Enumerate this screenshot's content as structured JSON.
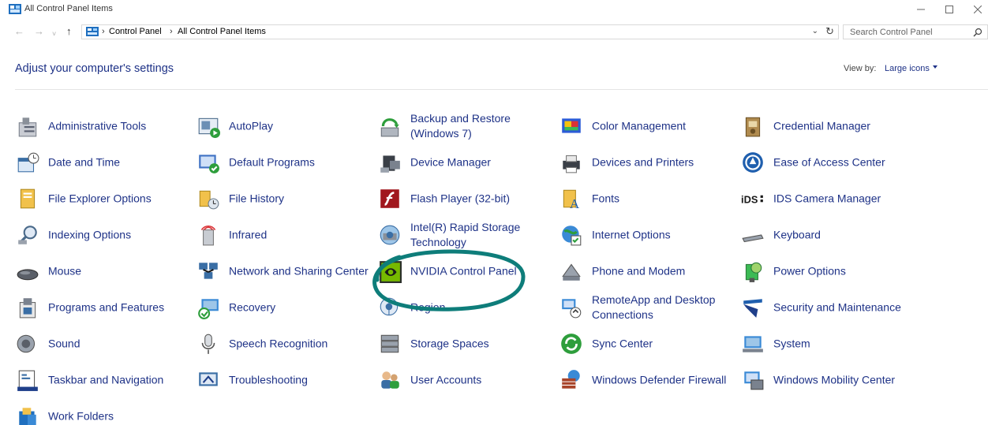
{
  "window": {
    "title": "All Control Panel Items"
  },
  "address": {
    "crumbs": [
      "Control Panel",
      "All Control Panel Items"
    ]
  },
  "search": {
    "placeholder": "Search Control Panel"
  },
  "header": {
    "heading": "Adjust your computer's settings",
    "view_by_label": "View by:",
    "view_by_value": "Large icons"
  },
  "items": [
    {
      "label": "Administrative Tools",
      "icon": "admin-tools-icon"
    },
    {
      "label": "AutoPlay",
      "icon": "autoplay-icon"
    },
    {
      "label": "Backup and Restore (Windows 7)",
      "icon": "backup-restore-icon"
    },
    {
      "label": "Color Management",
      "icon": "color-management-icon"
    },
    {
      "label": "Credential Manager",
      "icon": "credential-manager-icon"
    },
    {
      "label": "Date and Time",
      "icon": "date-time-icon"
    },
    {
      "label": "Default Programs",
      "icon": "default-programs-icon"
    },
    {
      "label": "Device Manager",
      "icon": "device-manager-icon"
    },
    {
      "label": "Devices and Printers",
      "icon": "devices-printers-icon"
    },
    {
      "label": "Ease of Access Center",
      "icon": "ease-of-access-icon"
    },
    {
      "label": "File Explorer Options",
      "icon": "file-explorer-options-icon"
    },
    {
      "label": "File History",
      "icon": "file-history-icon"
    },
    {
      "label": "Flash Player (32-bit)",
      "icon": "flash-player-icon"
    },
    {
      "label": "Fonts",
      "icon": "fonts-icon"
    },
    {
      "label": "IDS Camera Manager",
      "icon": "ids-camera-icon"
    },
    {
      "label": "Indexing Options",
      "icon": "indexing-options-icon"
    },
    {
      "label": "Infrared",
      "icon": "infrared-icon"
    },
    {
      "label": "Intel(R) Rapid Storage Technology",
      "icon": "intel-storage-icon"
    },
    {
      "label": "Internet Options",
      "icon": "internet-options-icon"
    },
    {
      "label": "Keyboard",
      "icon": "keyboard-icon"
    },
    {
      "label": "Mouse",
      "icon": "mouse-icon"
    },
    {
      "label": "Network and Sharing Center",
      "icon": "network-sharing-icon"
    },
    {
      "label": "NVIDIA Control Panel",
      "icon": "nvidia-icon"
    },
    {
      "label": "Phone and Modem",
      "icon": "phone-modem-icon"
    },
    {
      "label": "Power Options",
      "icon": "power-options-icon"
    },
    {
      "label": "Programs and Features",
      "icon": "programs-features-icon"
    },
    {
      "label": "Recovery",
      "icon": "recovery-icon"
    },
    {
      "label": "Region",
      "icon": "region-icon"
    },
    {
      "label": "RemoteApp and Desktop Connections",
      "icon": "remoteapp-icon"
    },
    {
      "label": "Security and Maintenance",
      "icon": "security-maintenance-icon"
    },
    {
      "label": "Sound",
      "icon": "sound-icon"
    },
    {
      "label": "Speech Recognition",
      "icon": "speech-recognition-icon"
    },
    {
      "label": "Storage Spaces",
      "icon": "storage-spaces-icon"
    },
    {
      "label": "Sync Center",
      "icon": "sync-center-icon"
    },
    {
      "label": "System",
      "icon": "system-icon"
    },
    {
      "label": "Taskbar and Navigation",
      "icon": "taskbar-icon"
    },
    {
      "label": "Troubleshooting",
      "icon": "troubleshooting-icon"
    },
    {
      "label": "User Accounts",
      "icon": "user-accounts-icon"
    },
    {
      "label": "Windows Defender Firewall",
      "icon": "firewall-icon"
    },
    {
      "label": "Windows Mobility Center",
      "icon": "mobility-center-icon"
    },
    {
      "label": "Work Folders",
      "icon": "work-folders-icon"
    }
  ],
  "colors": {
    "link": "#1e3287",
    "annotation": "#0e7d7a"
  }
}
